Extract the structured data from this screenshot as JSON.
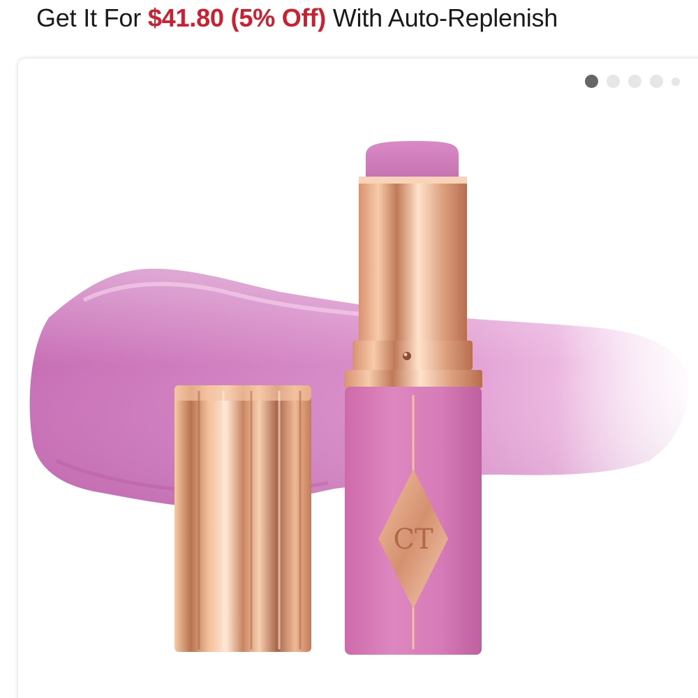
{
  "promo": {
    "prefix": "Get It For ",
    "price": "$41.80 (5% Off)",
    "suffix": " With Auto-Replenish"
  },
  "carousel": {
    "total_slides": 5,
    "active_index": 0
  },
  "colors": {
    "price_red": "#cc1f2f",
    "swatch_pink": "#d27ec0",
    "stick_pink": "#d575b4",
    "rose_gold": "#e3a07a"
  },
  "icons": {
    "brand_logo": "ct-diamond-monogram"
  }
}
